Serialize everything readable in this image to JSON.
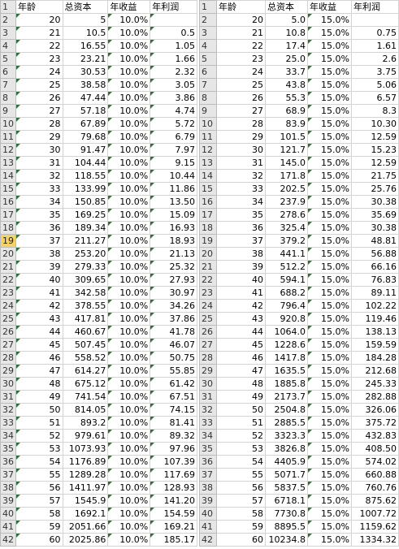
{
  "left_sheet": {
    "headers": [
      "年龄",
      "总资本",
      "年收益",
      "年利润"
    ],
    "rows": [
      [
        "20",
        "5",
        "10.0%",
        ""
      ],
      [
        "21",
        "10.5",
        "10.0%",
        "0.5"
      ],
      [
        "22",
        "16.55",
        "10.0%",
        "1.05"
      ],
      [
        "23",
        "23.21",
        "10.0%",
        "1.66"
      ],
      [
        "24",
        "30.53",
        "10.0%",
        "2.32"
      ],
      [
        "25",
        "38.58",
        "10.0%",
        "3.05"
      ],
      [
        "26",
        "47.44",
        "10.0%",
        "3.86"
      ],
      [
        "27",
        "57.18",
        "10.0%",
        "4.74"
      ],
      [
        "28",
        "67.89",
        "10.0%",
        "5.72"
      ],
      [
        "29",
        "79.68",
        "10.0%",
        "6.79"
      ],
      [
        "30",
        "91.47",
        "10.0%",
        "7.97"
      ],
      [
        "31",
        "104.44",
        "10.0%",
        "9.15"
      ],
      [
        "32",
        "118.55",
        "10.0%",
        "10.44"
      ],
      [
        "33",
        "133.99",
        "10.0%",
        "11.86"
      ],
      [
        "34",
        "150.85",
        "10.0%",
        "13.50"
      ],
      [
        "35",
        "169.25",
        "10.0%",
        "15.09"
      ],
      [
        "36",
        "189.34",
        "10.0%",
        "16.93"
      ],
      [
        "37",
        "211.27",
        "10.0%",
        "18.93"
      ],
      [
        "38",
        "253.20",
        "10.0%",
        "21.13"
      ],
      [
        "39",
        "279.33",
        "10.0%",
        "25.32"
      ],
      [
        "40",
        "309.65",
        "10.0%",
        "27.93"
      ],
      [
        "41",
        "342.58",
        "10.0%",
        "30.97"
      ],
      [
        "42",
        "378.55",
        "10.0%",
        "34.26"
      ],
      [
        "43",
        "417.81",
        "10.0%",
        "37.86"
      ],
      [
        "44",
        "460.67",
        "10.0%",
        "41.78"
      ],
      [
        "45",
        "507.45",
        "10.0%",
        "46.07"
      ],
      [
        "46",
        "558.52",
        "10.0%",
        "50.75"
      ],
      [
        "47",
        "614.27",
        "10.0%",
        "55.85"
      ],
      [
        "48",
        "675.12",
        "10.0%",
        "61.42"
      ],
      [
        "49",
        "741.54",
        "10.0%",
        "67.51"
      ],
      [
        "50",
        "814.05",
        "10.0%",
        "74.15"
      ],
      [
        "51",
        "893.2",
        "10.0%",
        "81.41"
      ],
      [
        "52",
        "979.61",
        "10.0%",
        "89.32"
      ],
      [
        "53",
        "1073.93",
        "10.0%",
        "97.96"
      ],
      [
        "54",
        "1176.89",
        "10.0%",
        "107.39"
      ],
      [
        "55",
        "1289.28",
        "10.0%",
        "117.69"
      ],
      [
        "56",
        "1411.97",
        "10.0%",
        "128.93"
      ],
      [
        "57",
        "1545.9",
        "10.0%",
        "141.20"
      ],
      [
        "58",
        "1692.1",
        "10.0%",
        "154.59"
      ],
      [
        "59",
        "2051.66",
        "10.0%",
        "169.21"
      ],
      [
        "60",
        "2025.86",
        "10.0%",
        "185.17"
      ]
    ],
    "row_numbers": [
      "1",
      "2",
      "3",
      "4",
      "5",
      "6",
      "7",
      "8",
      "9",
      "10",
      "11",
      "12",
      "13",
      "14",
      "15",
      "16",
      "17",
      "18",
      "19",
      "20",
      "21",
      "22",
      "23",
      "24",
      "25",
      "26",
      "27",
      "28",
      "29",
      "30",
      "31",
      "32",
      "33",
      "34",
      "35",
      "36",
      "37",
      "38",
      "39",
      "40",
      "41",
      "42"
    ],
    "selected_row_number": "19"
  },
  "right_sheet": {
    "headers": [
      "年龄",
      "总资本",
      "年收益",
      "年利润"
    ],
    "rows": [
      [
        "20",
        "5.0",
        "15.0%",
        ""
      ],
      [
        "21",
        "10.8",
        "15.0%",
        "0.75"
      ],
      [
        "22",
        "17.4",
        "15.0%",
        "1.61"
      ],
      [
        "23",
        "25.0",
        "15.0%",
        "2.6"
      ],
      [
        "24",
        "33.7",
        "15.0%",
        "3.75"
      ],
      [
        "25",
        "43.8",
        "15.0%",
        "5.06"
      ],
      [
        "26",
        "55.3",
        "15.0%",
        "6.57"
      ],
      [
        "27",
        "68.9",
        "15.0%",
        "8.3"
      ],
      [
        "28",
        "83.9",
        "15.0%",
        "10.30"
      ],
      [
        "29",
        "101.5",
        "15.0%",
        "12.59"
      ],
      [
        "30",
        "121.7",
        "15.0%",
        "15.23"
      ],
      [
        "31",
        "145.0",
        "15.0%",
        "12.59"
      ],
      [
        "32",
        "171.8",
        "15.0%",
        "21.75"
      ],
      [
        "33",
        "202.5",
        "15.0%",
        "25.76"
      ],
      [
        "34",
        "237.9",
        "15.0%",
        "30.38"
      ],
      [
        "35",
        "278.6",
        "15.0%",
        "35.69"
      ],
      [
        "36",
        "325.4",
        "15.0%",
        "30.38"
      ],
      [
        "37",
        "379.2",
        "15.0%",
        "48.81"
      ],
      [
        "38",
        "441.1",
        "15.0%",
        "56.88"
      ],
      [
        "39",
        "512.2",
        "15.0%",
        "66.16"
      ],
      [
        "40",
        "594.1",
        "15.0%",
        "76.83"
      ],
      [
        "41",
        "688.2",
        "15.0%",
        "89.11"
      ],
      [
        "42",
        "796.4",
        "15.0%",
        "102.22"
      ],
      [
        "43",
        "920.8",
        "15.0%",
        "119.46"
      ],
      [
        "44",
        "1064.0",
        "15.0%",
        "138.13"
      ],
      [
        "45",
        "1228.6",
        "15.0%",
        "159.59"
      ],
      [
        "46",
        "1417.8",
        "15.0%",
        "184.28"
      ],
      [
        "47",
        "1635.5",
        "15.0%",
        "212.68"
      ],
      [
        "48",
        "1885.8",
        "15.0%",
        "245.33"
      ],
      [
        "49",
        "2173.7",
        "15.0%",
        "282.88"
      ],
      [
        "50",
        "2504.8",
        "15.0%",
        "326.06"
      ],
      [
        "51",
        "2885.5",
        "15.0%",
        "375.72"
      ],
      [
        "52",
        "3323.3",
        "15.0%",
        "432.83"
      ],
      [
        "53",
        "3826.8",
        "15.0%",
        "408.50"
      ],
      [
        "54",
        "4405.9",
        "15.0%",
        "574.02"
      ],
      [
        "55",
        "5071.7",
        "15.0%",
        "660.88"
      ],
      [
        "56",
        "5837.5",
        "15.0%",
        "760.76"
      ],
      [
        "57",
        "6718.1",
        "15.0%",
        "875.62"
      ],
      [
        "58",
        "7730.8",
        "15.0%",
        "1007.72"
      ],
      [
        "59",
        "8895.5",
        "15.0%",
        "1159.62"
      ],
      [
        "60",
        "10234.8",
        "15.0%",
        "1334.32"
      ]
    ],
    "row_numbers": [
      "1",
      "2",
      "3",
      "4",
      "5",
      "6",
      "7",
      "8",
      "9",
      "10",
      "11",
      "12",
      "13",
      "14",
      "15",
      "16",
      "17",
      "18",
      "19",
      "20",
      "21",
      "22",
      "23",
      "24",
      "25",
      "26",
      "27",
      "28",
      "29",
      "30",
      "31",
      "32",
      "33",
      "34",
      "35",
      "36",
      "37",
      "38",
      "39",
      "40",
      "41",
      "42"
    ]
  },
  "colors": {
    "row_header_bg": "#e6e6e6",
    "selected_row_header_bg": "#f3d26a",
    "grid_line": "#d4d4d4",
    "error_triangle": "#1e7b34"
  }
}
